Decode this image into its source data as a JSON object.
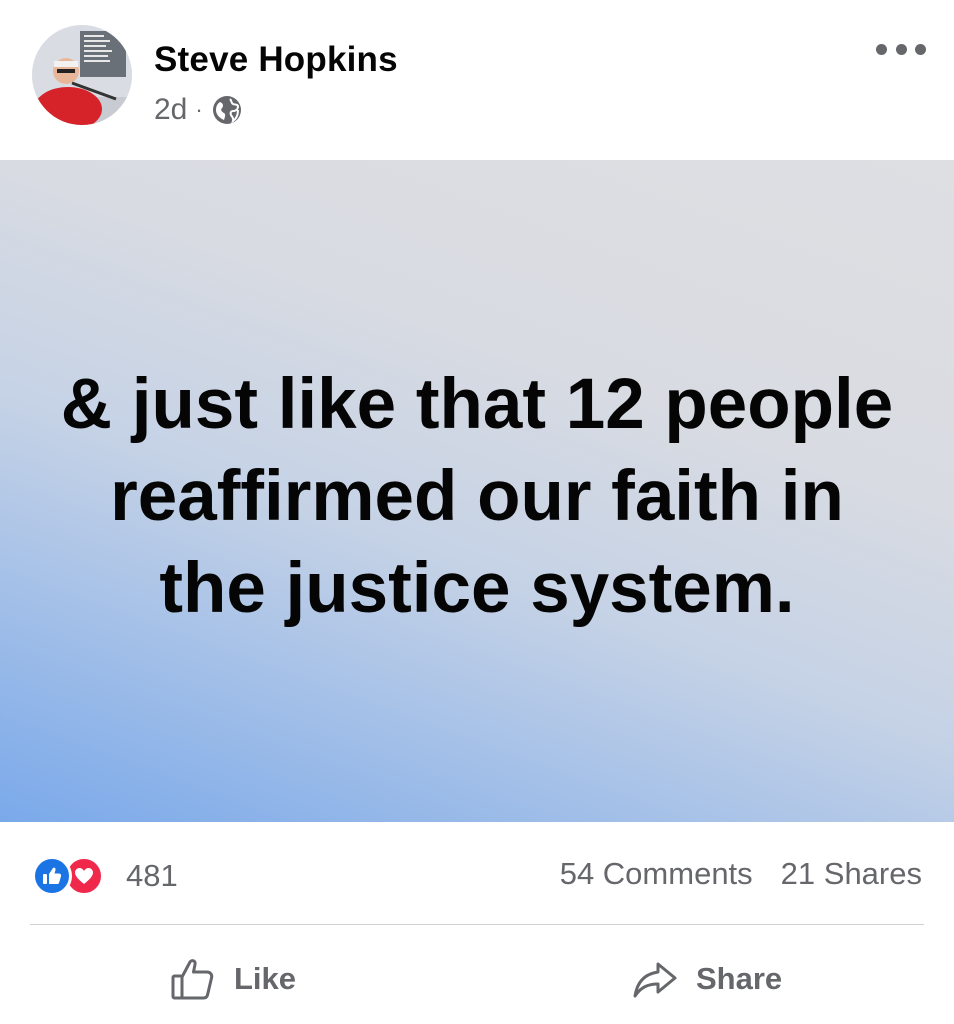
{
  "post": {
    "author": "Steve Hopkins",
    "time": "2d",
    "separator": "·",
    "privacy_icon": "globe-icon",
    "menu_icon": "more-options-icon",
    "text": "& just like that 12 people reaffirmed our faith in the justice system.",
    "background_colors": [
      "#dedfe3",
      "#7aa9ea"
    ]
  },
  "stats": {
    "reaction_icons": [
      "like-reaction-icon",
      "love-reaction-icon"
    ],
    "reaction_count": "481",
    "comments": "54 Comments",
    "shares": "21 Shares"
  },
  "actions": {
    "like_label": "Like",
    "share_label": "Share"
  },
  "colors": {
    "like_blue": "#1b74e4",
    "love_red": "#f0284a",
    "secondary_text": "#65676b"
  }
}
